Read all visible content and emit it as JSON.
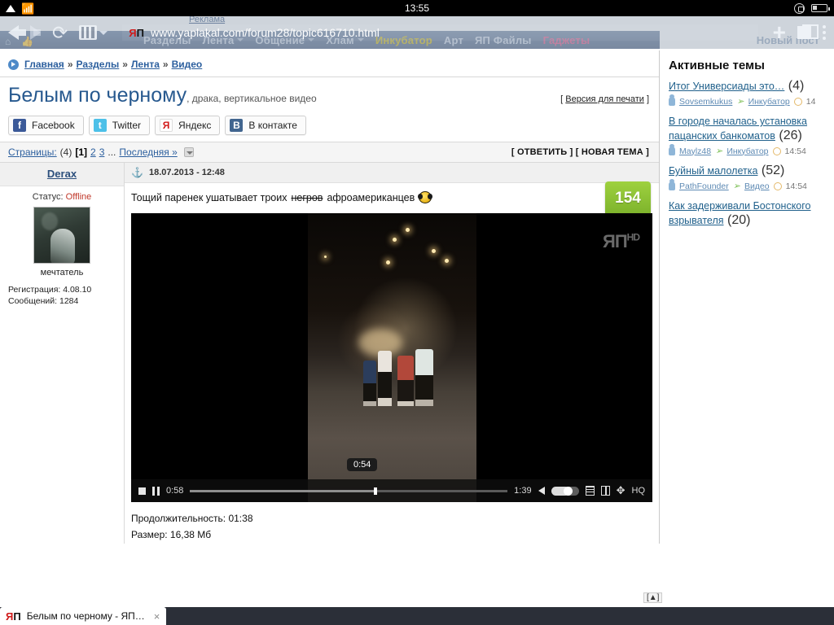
{
  "status_bar": {
    "clock": "13:55",
    "signal_icon": "signal-triangle-icon",
    "wifi_icon": "wifi-icon",
    "rotation_lock_icon": "rotation-lock-icon",
    "battery_icon": "battery-icon"
  },
  "browser": {
    "back_icon": "back-arrow-icon",
    "forward_icon": "forward-arrow-icon",
    "reload_icon": "reload-icon",
    "film_icon": "film-strip-icon",
    "url": "www.yaplakal.com/forum28/topic616710.html",
    "favicon_left": "Я",
    "favicon_right": "П",
    "new_tab_icon": "plus-icon",
    "tabs_icon": "tabs-icon",
    "menu_icon": "kebab-menu-icon",
    "tab_title": "Белым по черному - ЯП…",
    "tab_close": "×"
  },
  "site_nav": {
    "ad_label": "Реклама",
    "new_post": "Новый пост",
    "home_icon": "home-icon",
    "thumb_icon": "thumbs-up-icon",
    "items": [
      {
        "label": "Разделы",
        "caret": false,
        "style": ""
      },
      {
        "label": "Лента",
        "caret": true,
        "style": ""
      },
      {
        "label": "Общение",
        "caret": true,
        "style": ""
      },
      {
        "label": "Хлам",
        "caret": true,
        "style": ""
      },
      {
        "label": "Инкубатор",
        "caret": false,
        "style": "amber"
      },
      {
        "label": "Арт",
        "caret": false,
        "style": ""
      },
      {
        "label": "ЯП Файлы",
        "caret": false,
        "style": ""
      },
      {
        "label": "Гаджеты",
        "caret": false,
        "style": "pink"
      }
    ]
  },
  "breadcrumb": {
    "icon": "play-circle-icon",
    "items": [
      "Главная",
      "Разделы",
      "Лента",
      "Видео"
    ],
    "separator": "»"
  },
  "topic": {
    "title": "Белым по черному",
    "subtitle": ", драка, вертикальное видео",
    "print_open": "[",
    "print_label": "Версия для печати",
    "print_close": "]"
  },
  "share_buttons": [
    {
      "label": "Facebook",
      "glyph": "f",
      "cls": "fb"
    },
    {
      "label": "Twitter",
      "glyph": "t",
      "cls": "tw"
    },
    {
      "label": "Яндекс",
      "glyph": "Я",
      "cls": "ya"
    },
    {
      "label": "В контакте",
      "glyph": "В",
      "cls": "vk"
    }
  ],
  "pager": {
    "label": "Страницы:",
    "total": "(4)",
    "pages": [
      "[1]",
      "2",
      "3"
    ],
    "ellipsis": "...",
    "last": "Последняя »",
    "reply": "[ ОТВЕТИТЬ ]",
    "new_topic": "[ НОВАЯ ТЕМА ]"
  },
  "post": {
    "author": "Derax",
    "status_label": "Статус:",
    "status_value": "Offline",
    "user_title": "мечтатель",
    "registration": "Регистрация: 4.08.10",
    "messages": "Сообщений: 1284",
    "date": "18.07.2013 - 12:48",
    "text_before": "Тощий паренек ушатывает троих",
    "text_struck": "негров",
    "text_after": "афроамериканцев",
    "rating": "154",
    "rating_minus": "−",
    "rating_plus": "+"
  },
  "video": {
    "watermark": "ЯП",
    "watermark_hd": "HD",
    "seek_tooltip": "0:54",
    "current_time": "0:58",
    "total_time": "1:39",
    "quality": "HQ",
    "duration_line": "Продолжительность: 01:38",
    "size_line": "Размер: 16,38 Мб"
  },
  "sidebar": {
    "heading": "Активные темы",
    "topics": [
      {
        "title": "Итог Универсиады это…",
        "count": "(4)",
        "author": "Sovsemkukus",
        "forum": "Инкубатор",
        "time": "14"
      },
      {
        "title": "В городе началась установка пацанских банкоматов",
        "count": "(26)",
        "author": "Maylz48",
        "forum": "Инкубатор",
        "time": "14:54"
      },
      {
        "title": "Буйный малолетка",
        "count": "(52)",
        "author": "PathFounder",
        "forum": "Видео",
        "time": "14:54"
      },
      {
        "title": "Как задерживали Бостонского взрывателя",
        "count": "(20)",
        "author": "",
        "forum": "",
        "time": ""
      }
    ]
  },
  "scroll_top": "[▲]"
}
